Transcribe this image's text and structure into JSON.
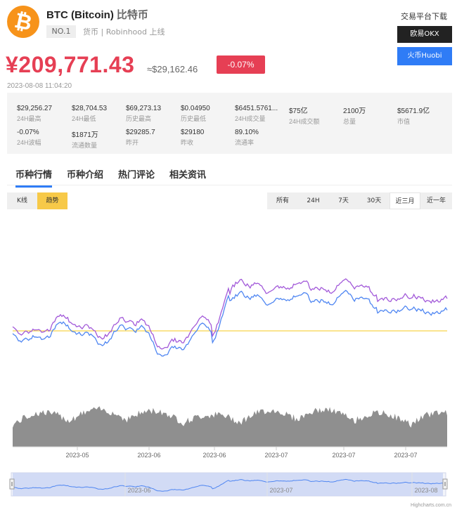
{
  "coin": {
    "logo_glyph": "₿",
    "name": "BTC (Bitcoin)",
    "name_cn": "比特币",
    "rank": "NO.1",
    "tags": "货币 | Robinhood 上线"
  },
  "exchange": {
    "heading": "交易平台下载",
    "okx_label": "欧易OKX",
    "huobi_label": "火币Huobi"
  },
  "price": {
    "cny": "¥209,771.43",
    "usd": "≈$29,162.46",
    "change": "-0.07%",
    "timestamp": "2023-08-08 11:04:20"
  },
  "stats": [
    {
      "value": "$29,256.27",
      "label": "24H最高"
    },
    {
      "value": "$28,704.53",
      "label": "24H最低"
    },
    {
      "value": "$69,273.13",
      "label": "历史最高"
    },
    {
      "value": "$0.04950",
      "label": "历史最低"
    },
    {
      "value": "$6451.5761...",
      "label": "24H成交量"
    },
    {
      "value": "$75亿",
      "label": "24H成交额"
    },
    {
      "value": "2100万",
      "label": "总量"
    },
    {
      "value": "$5671.9亿",
      "label": "市值"
    },
    {
      "value": "-0.07%",
      "label": "24H波幅"
    },
    {
      "value": "$1871万",
      "label": "流通数量"
    },
    {
      "value": "$29285.7",
      "label": "昨开"
    },
    {
      "value": "$29180",
      "label": "昨收"
    },
    {
      "value": "89.10%",
      "label": "流通率"
    }
  ],
  "tabs": [
    "币种行情",
    "币种介绍",
    "热门评论",
    "相关资讯"
  ],
  "view_toggle": {
    "kline": "K线",
    "trend": "趋势"
  },
  "ranges": [
    "所有",
    "24H",
    "7天",
    "30天",
    "近三月",
    "近一年"
  ],
  "active_range": "近三月",
  "chart_data": {
    "type": "line",
    "x_ticks": [
      "2023-05",
      "2023-06",
      "2023-06",
      "2023-07",
      "2023-07",
      "2023-07"
    ],
    "navigator_ticks": [
      "2023-06",
      "2023-07",
      "2023-08"
    ],
    "series": [],
    "reference_line": true,
    "volume_area": true,
    "colors": {
      "line_purple": "#a259d9",
      "line_blue": "#4f86f2",
      "ref_line": "#f7d34b",
      "volume": "#8f8f8f",
      "navigator": "#cdd6f3"
    }
  },
  "credit": "Highcharts.com.cn"
}
